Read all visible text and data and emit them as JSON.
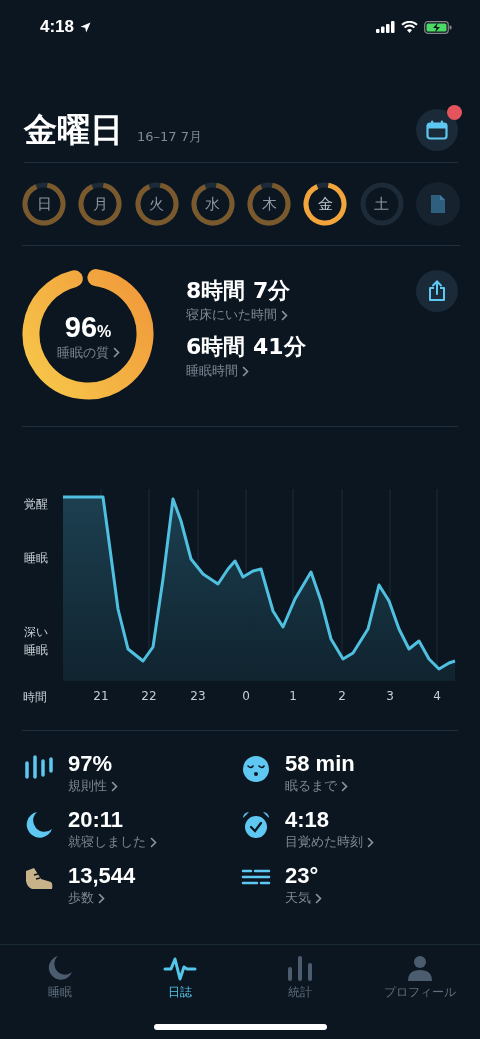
{
  "status_bar": {
    "time": "4:18"
  },
  "header": {
    "title": "金曜日",
    "date_range": "16–17 7月",
    "calendar_badge": true
  },
  "days": [
    {
      "label": "日",
      "scored": true,
      "selected": false
    },
    {
      "label": "月",
      "scored": true,
      "selected": false
    },
    {
      "label": "火",
      "scored": true,
      "selected": false
    },
    {
      "label": "水",
      "scored": true,
      "selected": false
    },
    {
      "label": "木",
      "scored": true,
      "selected": false
    },
    {
      "label": "金",
      "scored": true,
      "selected": true
    },
    {
      "label": "土",
      "scored": false,
      "selected": false
    }
  ],
  "summary": {
    "quality": {
      "value": "96",
      "unit": "%",
      "label": "睡眠の質",
      "level": 0.96
    },
    "metrics": [
      {
        "value": "8時間 7分",
        "label": "寝床にいた時間"
      },
      {
        "value": "6時間 41分",
        "label": "睡眠時間"
      }
    ]
  },
  "sleep_graph": {
    "y_labels": [
      "覚醒",
      "睡眠",
      "深い睡眠"
    ],
    "x_axis_label": "時間",
    "x_labels": [
      "21",
      "22",
      "23",
      "0",
      "1",
      "2",
      "3",
      "4"
    ]
  },
  "stats": [
    {
      "kind": "regularity",
      "value": "97%",
      "label": "規則性"
    },
    {
      "kind": "latency",
      "value": "58 min",
      "label": "眠るまで"
    },
    {
      "kind": "bedtime",
      "value": "20:11",
      "label": "就寝しました"
    },
    {
      "kind": "wakeup",
      "value": "4:18",
      "label": "目覚めた時刻"
    },
    {
      "kind": "steps",
      "value": "13,544",
      "label": "歩数"
    },
    {
      "kind": "weather",
      "value": "23°",
      "label": "天気"
    }
  ],
  "tab_bar": [
    {
      "kind": "sleep",
      "label": "睡眠",
      "selected": false
    },
    {
      "kind": "journal",
      "label": "日誌",
      "selected": true
    },
    {
      "kind": "stats",
      "label": "統計",
      "selected": false
    },
    {
      "kind": "profile",
      "label": "プロフィール",
      "selected": false
    }
  ]
}
